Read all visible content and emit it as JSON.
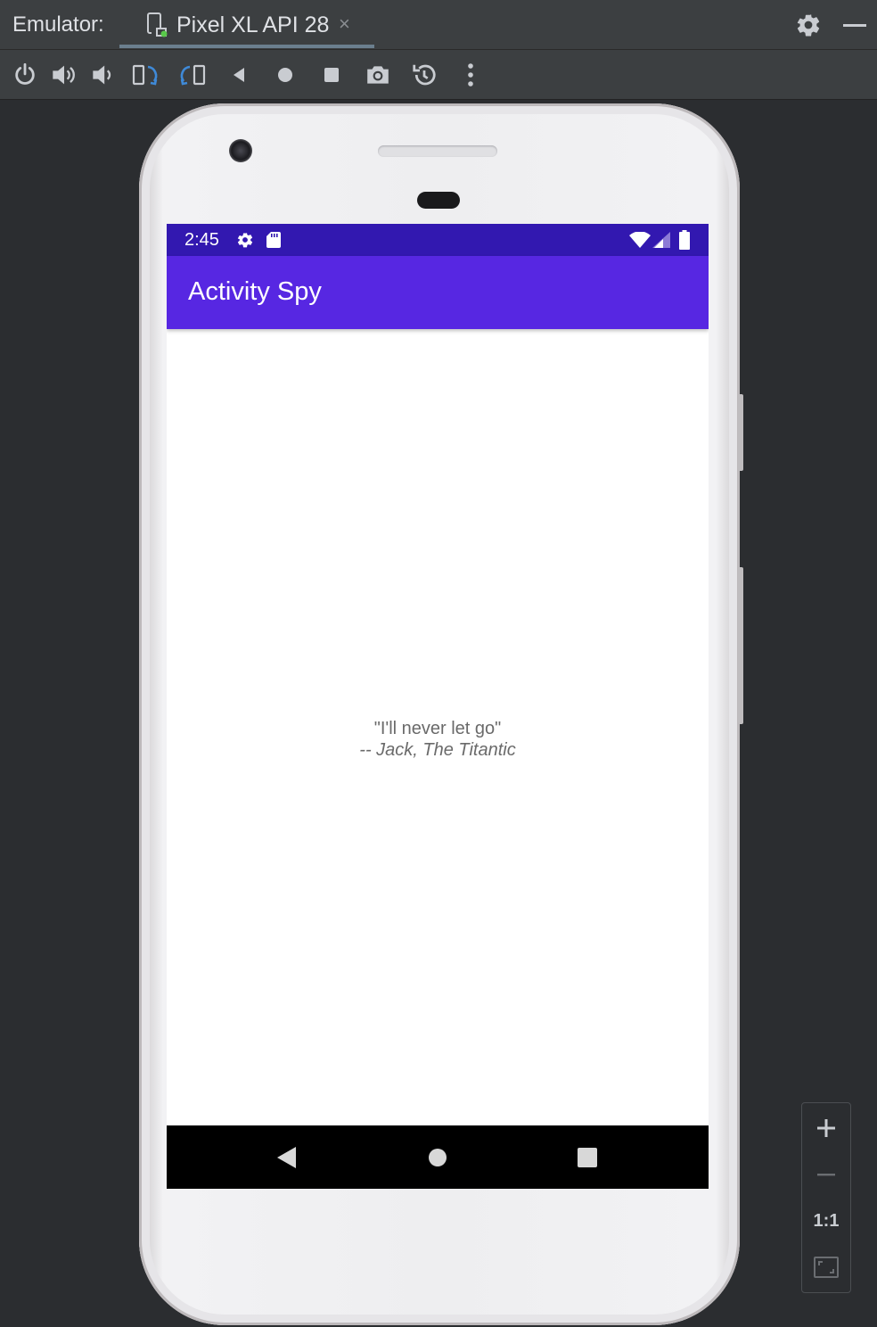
{
  "window": {
    "title": "Emulator:",
    "tab_label": "Pixel XL API 28",
    "tab_close": "×"
  },
  "toolbar": {
    "items": [
      "power-icon",
      "volume-up-icon",
      "volume-down-icon",
      "rotate-left-icon",
      "rotate-right-icon",
      "back-icon",
      "home-icon",
      "overview-icon",
      "screenshot-icon",
      "snapshot-icon",
      "more-icon"
    ]
  },
  "device": {
    "status_time": "2:45",
    "app_title": "Activity Spy",
    "quote_text": "\"I'll never let go\"",
    "quote_author": "-- Jack, The Titantic"
  },
  "zoom": {
    "one_to_one": "1:1"
  },
  "colors": {
    "status_bar": "#3218b0",
    "app_bar": "#5727e2",
    "ide_background": "#2b2d30",
    "ide_panel": "#3c3f41"
  }
}
